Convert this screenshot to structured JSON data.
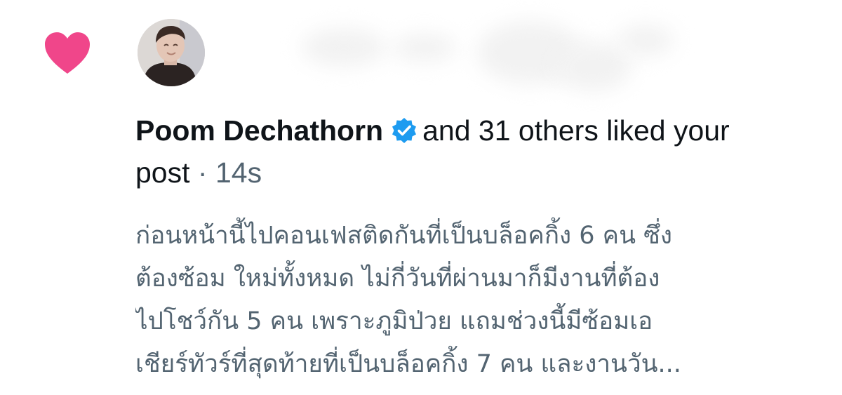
{
  "notification": {
    "type_icon": "heart-icon",
    "icon_color": "#f0468a",
    "author": {
      "name": "Poom Dechathorn",
      "verified": true,
      "verified_color": "#1d9bf0",
      "avatar_icon": "user-avatar"
    },
    "action_text": "and 31 others liked your",
    "action_text_continued": "post",
    "separator": "·",
    "timestamp": "14s",
    "post_preview": [
      "ก่อนหน้านี้ไปคอนเฟสติดกันที่เป็นบล็อคกิ้ง 6 คน ซึ่ง",
      "ต้องซ้อม ใหม่ทั้งหมด ไม่กี่วันที่ผ่านมาก็มีงานที่ต้อง",
      "ไปโชว์กัน 5 คน เพราะภูมิป่วย แถมช่วงนี้มีซ้อมเอ",
      "เชียร์ทัวร์ที่สุดท้ายที่เป็นบล็อคกิ้ง 7 คน และงานวัน..."
    ]
  }
}
